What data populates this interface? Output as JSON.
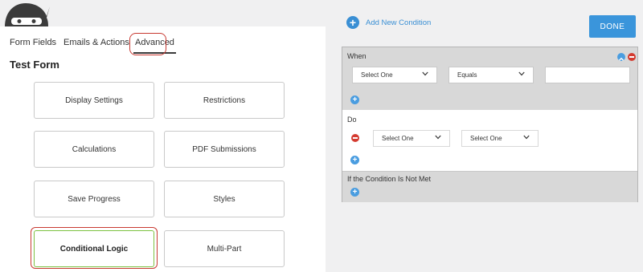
{
  "tabs": [
    {
      "label": "Form Fields"
    },
    {
      "label": "Emails & Actions"
    },
    {
      "label": "Advanced"
    }
  ],
  "form_title": "Test Form",
  "settings_cards": [
    {
      "label": "Display Settings"
    },
    {
      "label": "Restrictions"
    },
    {
      "label": "Calculations"
    },
    {
      "label": "PDF Submissions"
    },
    {
      "label": "Save Progress"
    },
    {
      "label": "Styles"
    },
    {
      "label": "Conditional Logic"
    },
    {
      "label": "Multi-Part"
    }
  ],
  "condition_panel": {
    "add_condition_label": "Add New Condition",
    "done_label": "DONE",
    "when": {
      "label": "When",
      "field_select": "Select One",
      "operator_select": "Equals",
      "value": ""
    },
    "do": {
      "label": "Do",
      "action_select": "Select One",
      "target_select": "Select One"
    },
    "else": {
      "label": "If the Condition Is Not Met"
    }
  },
  "colors": {
    "accent": "#3a95db",
    "highlight": "#c83a32",
    "active_card_border": "#7dc242",
    "remove": "#d43b30"
  }
}
